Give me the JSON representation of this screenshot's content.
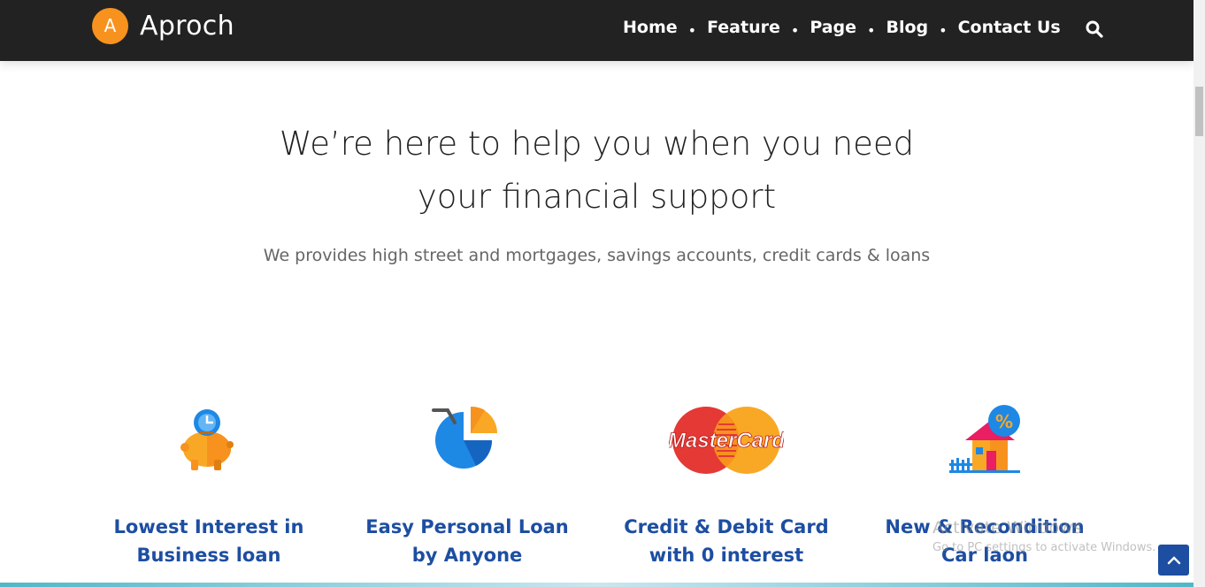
{
  "brand": {
    "badge_letter": "A",
    "name": "Aproch",
    "color": "#f7921e"
  },
  "nav": {
    "items": [
      "Home",
      "Feature",
      "Page",
      "Blog",
      "Contact Us"
    ],
    "separator": "•",
    "search_icon": "search-icon"
  },
  "hero": {
    "title_line1": "We’re here to help you when you need",
    "title_line2": "your financial support",
    "subtitle": "We provides high street and mortgages, savings accounts, credit cards & loans"
  },
  "features": [
    {
      "icon": "piggy-bank-icon",
      "line1": "Lowest Interest in",
      "line2": "Business loan"
    },
    {
      "icon": "pie-chart-icon",
      "line1": "Easy Personal Loan",
      "line2": "by Anyone"
    },
    {
      "icon": "mastercard-icon",
      "line1": "Credit & Debit Card",
      "line2": "with 0 interest",
      "logo_text": "MasterCard"
    },
    {
      "icon": "house-percent-icon",
      "line1": "New & Recondition",
      "line2": "Car laon"
    }
  ],
  "watermark": {
    "line1": "Activate Windows",
    "line2": "Go to PC settings to activate Windows."
  },
  "colors": {
    "navbar": "#222222",
    "accent_blue": "#1d4ea1",
    "orange": "#f7921e"
  }
}
